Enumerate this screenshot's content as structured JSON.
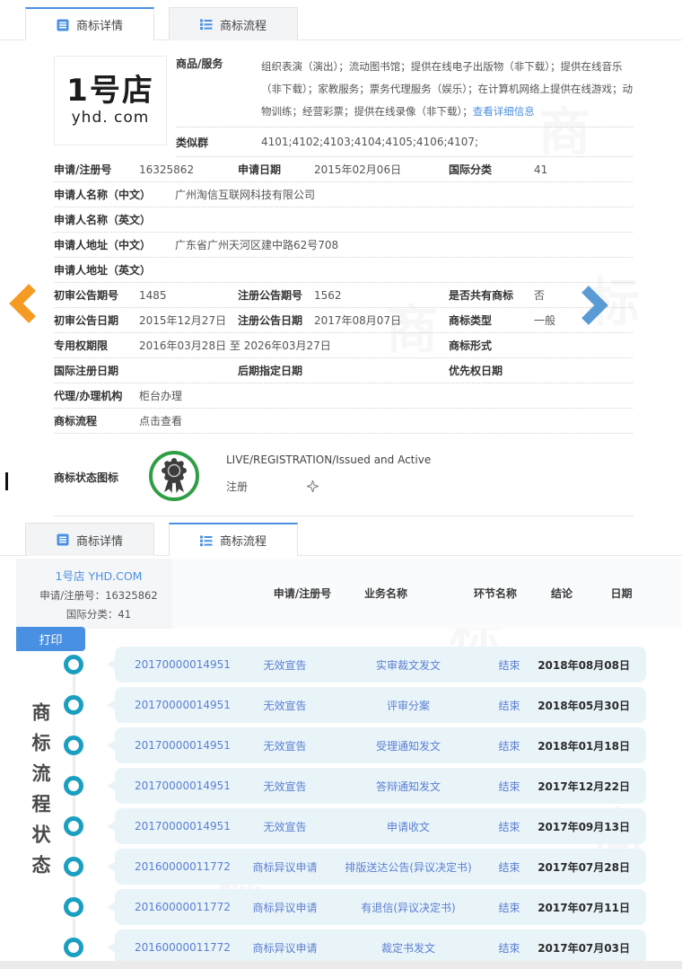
{
  "tabs": {
    "detail_label": "商标详情",
    "process_label": "商标流程"
  },
  "detail": {
    "logo_line1": "1号店",
    "logo_line2": "yhd. com",
    "goods_label": "商品/服务",
    "goods_text": "组织表演（演出）；流动图书馆；提供在线电子出版物（非下载）；提供在线音乐（非下载）；家教服务；票务代理服务（娱乐）；在计算机网络上提供在线游戏；动物训练；经营彩票；提供在线录像（非下载）；",
    "goods_link": "查看详细信息",
    "similar_label": "类似群",
    "similar_value": "4101;4102;4103;4104;4105;4106;4107;",
    "fields": [
      {
        "cells": [
          {
            "label": "申请/注册号",
            "value": "16325862"
          },
          {
            "label": "申请日期",
            "value": "2015年02月06日"
          },
          {
            "label": "国际分类",
            "value": "41"
          }
        ]
      },
      {
        "cells": [
          {
            "label": "申请人名称（中文）",
            "value": "广州淘信互联网科技有限公司"
          }
        ]
      },
      {
        "cells": [
          {
            "label": "申请人名称（英文）",
            "value": ""
          }
        ]
      },
      {
        "cells": [
          {
            "label": "申请人地址（中文）",
            "value": "广东省广州天河区建中路62号708"
          }
        ]
      },
      {
        "cells": [
          {
            "label": "申请人地址（英文）",
            "value": ""
          }
        ]
      },
      {
        "cells": [
          {
            "label": "初审公告期号",
            "value": "1485"
          },
          {
            "label": "注册公告期号",
            "value": "1562"
          },
          {
            "label": "是否共有商标",
            "value": "否"
          }
        ]
      },
      {
        "cells": [
          {
            "label": "初审公告日期",
            "value": "2015年12月27日"
          },
          {
            "label": "注册公告日期",
            "value": "2017年08月07日"
          },
          {
            "label": "商标类型",
            "value": "一般"
          }
        ]
      },
      {
        "cells": [
          {
            "label": "专用权期限",
            "value": "2016年03月28日 至 2026年03月27日"
          },
          {
            "label": "商标形式",
            "value": ""
          }
        ]
      },
      {
        "cells": [
          {
            "label": "国际注册日期",
            "value": ""
          },
          {
            "label": "后期指定日期",
            "value": ""
          },
          {
            "label": "优先权日期",
            "value": ""
          }
        ]
      },
      {
        "cells": [
          {
            "label": "代理/办理机构",
            "value": "柜台办理"
          }
        ]
      },
      {
        "cells": [
          {
            "label": "商标流程",
            "value": "点击查看"
          }
        ]
      }
    ],
    "status_label": "商标状态图标",
    "status_line1": "LIVE/REGISTRATION/Issued and Active",
    "status_line2": "注册"
  },
  "process": {
    "info_title": "1号店 YHD.COM",
    "info_reg": "申请/注册号：16325862",
    "info_class": "国际分类：41",
    "print_label": "打印",
    "columns": [
      "申请/注册号",
      "业务名称",
      "环节名称",
      "结论",
      "日期"
    ],
    "side_label": "商标流程状态",
    "rows": [
      {
        "no": "20170000014951",
        "business": "无效宣告",
        "stage": "实审裁文发文",
        "result": "结束",
        "date": "2018年08月08日"
      },
      {
        "no": "20170000014951",
        "business": "无效宣告",
        "stage": "评审分案",
        "result": "结束",
        "date": "2018年05月30日"
      },
      {
        "no": "20170000014951",
        "business": "无效宣告",
        "stage": "受理通知发文",
        "result": "结束",
        "date": "2018年01月18日"
      },
      {
        "no": "20170000014951",
        "business": "无效宣告",
        "stage": "答辩通知发文",
        "result": "结束",
        "date": "2017年12月22日"
      },
      {
        "no": "20170000014951",
        "business": "无效宣告",
        "stage": "申请收文",
        "result": "结束",
        "date": "2017年09月13日"
      },
      {
        "no": "20160000011772",
        "business": "商标异议申请",
        "stage": "排版送达公告(异议决定书)",
        "result": "结束",
        "date": "2017年07月28日"
      },
      {
        "no": "20160000011772",
        "business": "商标异议申请",
        "stage": "有退信(异议决定书)",
        "result": "结束",
        "date": "2017年07月11日"
      },
      {
        "no": "20160000011772",
        "business": "商标异议申请",
        "stage": "裁定书发文",
        "result": "结束",
        "date": "2017年07月03日"
      }
    ]
  },
  "watermark": {
    "glyph_a": "商",
    "glyph_b": "标"
  },
  "colors": {
    "accent": "#4a90e2",
    "row_text_blue": "#5b7fd1",
    "timeline_teal": "#1b9fc0",
    "badge_green": "#2f9e44",
    "arrow_left_orange": "#f59a23",
    "arrow_right_blue": "#5b9bd5",
    "bubble_bg": "#e9f4f9"
  }
}
